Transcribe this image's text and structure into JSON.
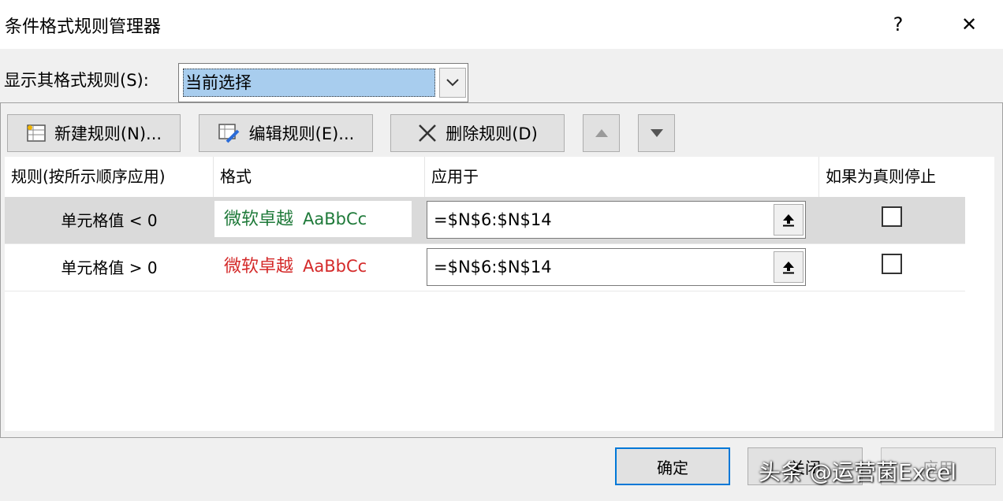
{
  "window": {
    "title": "条件格式规则管理器",
    "help_glyph": "?",
    "close_glyph": "✕"
  },
  "show_rules": {
    "label": "显示其格式规则(S):",
    "selected": "当前选择"
  },
  "toolbar": {
    "new_rule": "新建规则(N)...",
    "edit_rule": "编辑规则(E)...",
    "delete_rule": "删除规则(D)"
  },
  "table": {
    "headers": [
      "规则(按所示顺序应用)",
      "格式",
      "应用于",
      "如果为真则停止"
    ],
    "rows": [
      {
        "rule": "单元格值 < 0",
        "format_cn": "微软卓越",
        "format_en": "AaBbCc",
        "format_color": "#1f7a3a",
        "applies_to": "=$N$6:$N$14",
        "stop_if_true": false
      },
      {
        "rule": "单元格值 > 0",
        "format_cn": "微软卓越",
        "format_en": "AaBbCc",
        "format_color": "#d42a2a",
        "applies_to": "=$N$6:$N$14",
        "stop_if_true": false
      }
    ]
  },
  "footer": {
    "ok": "确定",
    "close": "关闭",
    "apply": "应用",
    "watermark": "头条 @运营菌Excel"
  }
}
